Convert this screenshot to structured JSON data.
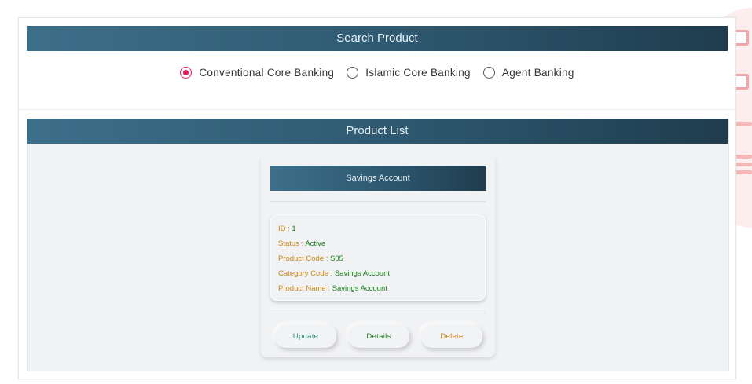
{
  "search": {
    "title": "Search Product",
    "options": [
      {
        "label": "Conventional Core Banking",
        "checked": true
      },
      {
        "label": "Islamic Core Banking",
        "checked": false
      },
      {
        "label": "Agent Banking",
        "checked": false
      }
    ]
  },
  "product_list": {
    "title": "Product List",
    "card": {
      "title": "Savings Account",
      "fields": [
        {
          "key": "ID : ",
          "value": "1"
        },
        {
          "key": "Status : ",
          "value": "Active"
        },
        {
          "key": "Product Code : ",
          "value": "S05"
        },
        {
          "key": "Category Code : ",
          "value": "Savings Account"
        },
        {
          "key": "Product Name : ",
          "value": "Savings Account"
        }
      ],
      "buttons": {
        "update": "Update",
        "details": "Details",
        "delete": "Delete"
      }
    }
  },
  "colors": {
    "banner_start": "#3d6f8a",
    "banner_end": "#1f3d4e",
    "radio_accent": "#e2185b",
    "field_key": "#c8851a",
    "field_value": "#1a7d1a"
  }
}
